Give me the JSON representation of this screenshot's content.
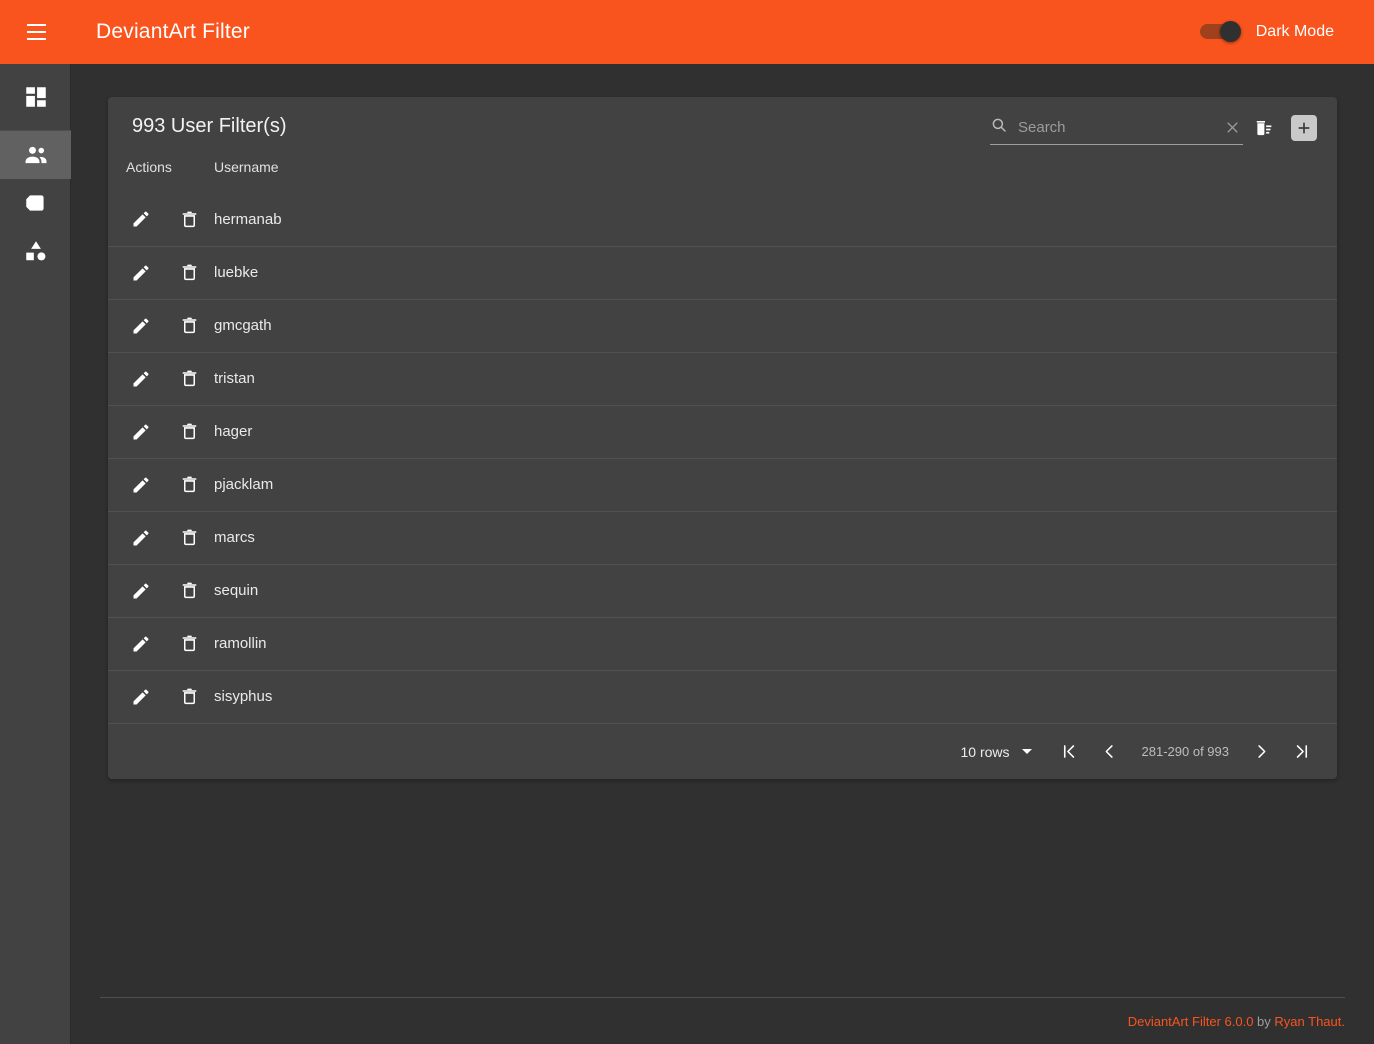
{
  "appbar": {
    "menu_icon": "hamburger-menu-icon",
    "title": "DeviantArt Filter",
    "dark_mode_label": "Dark Mode",
    "dark_mode_on": true,
    "background_color": "#f9541e"
  },
  "sidebar": {
    "items": [
      {
        "id": "dashboard",
        "icon": "dashboard-icon",
        "active": false
      },
      {
        "id": "users",
        "icon": "people-icon",
        "active": true
      },
      {
        "id": "tags",
        "icon": "tag-icon",
        "active": false
      },
      {
        "id": "categories",
        "icon": "category-icon",
        "active": false
      }
    ]
  },
  "card": {
    "title": "993 User Filter(s)",
    "search": {
      "placeholder": "Search",
      "value": "",
      "search_icon": "search-icon",
      "clear_icon": "close-icon"
    },
    "delete_all_icon": "delete-sweep-icon",
    "add_icon": "add-icon"
  },
  "table": {
    "columns": [
      "Actions",
      "Username"
    ],
    "rows": [
      {
        "username": "hermanab"
      },
      {
        "username": "luebke"
      },
      {
        "username": "gmcgath"
      },
      {
        "username": "tristan"
      },
      {
        "username": "hager"
      },
      {
        "username": "pjacklam"
      },
      {
        "username": "marcs"
      },
      {
        "username": "sequin"
      },
      {
        "username": "ramollin"
      },
      {
        "username": "sisyphus"
      }
    ],
    "row_actions": {
      "edit_icon": "edit-pencil-icon",
      "delete_icon": "delete-trash-icon"
    }
  },
  "paginator": {
    "rows_per_page_label": "10 rows",
    "range_label": "281-290 of 993",
    "first_page_icon": "first-page-icon",
    "prev_page_icon": "chevron-left-icon",
    "next_page_icon": "chevron-right-icon",
    "last_page_icon": "last-page-icon"
  },
  "footer": {
    "app_link": "DeviantArt Filter 6.0.0",
    "by_text": " by ",
    "author_link": "Ryan Thaut.",
    "link_color": "#f9541e"
  }
}
